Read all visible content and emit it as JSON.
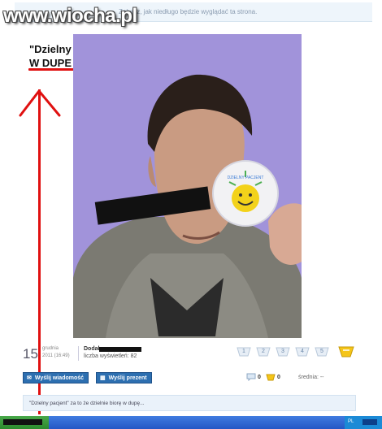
{
  "site": {
    "logo": "www.wiocha.pl"
  },
  "banner": {
    "text": "Zobacz, jak niedługo będzie wyglądać ta strona."
  },
  "post": {
    "caption_line1": "\"Dzielny pacjent\" za to że dzielnie BIORE",
    "caption_line2": "W DUPE",
    "sticker_text": "DZIELNY PACJENT",
    "date_day": "15",
    "date_month": "grudnia",
    "date_time": "2011 (16:49)",
    "added_label": "Dodał",
    "views_label": "liczba wyświetleń: 82",
    "comment_preview": "\"Dzielny pacjent\" za to że dzielnie biorę w dupę..."
  },
  "rating": {
    "options": [
      "1",
      "2",
      "3",
      "4",
      "5"
    ]
  },
  "buttons": {
    "send_message": "Wyślij wiadomość",
    "send_gift": "Wyślij prezent"
  },
  "stats": {
    "comments": "0",
    "gifts": "0",
    "average_label": "średnia: --"
  },
  "taskbar": {
    "language": "PL"
  },
  "colors": {
    "accent": "#2d6fb0",
    "annotation_red": "#e01010",
    "photo_wall": "#9a8ad6"
  }
}
